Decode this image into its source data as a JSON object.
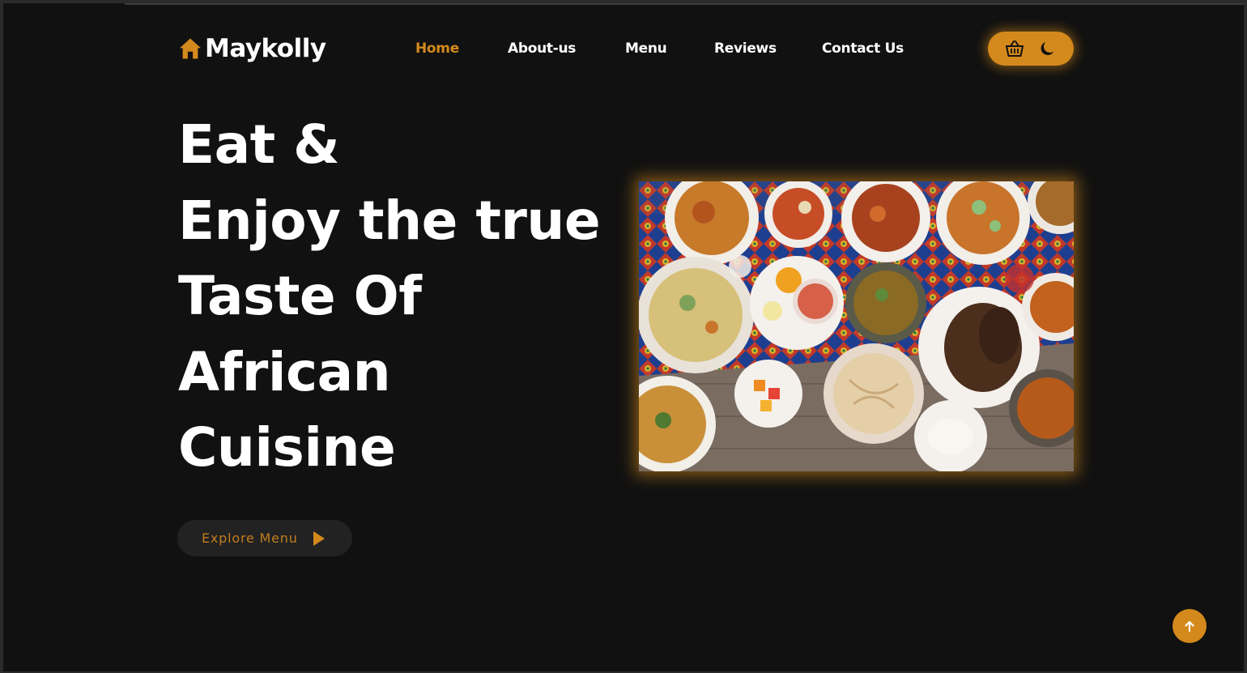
{
  "brand": {
    "name": "Maykolly",
    "icon": "home-icon"
  },
  "nav": {
    "items": [
      {
        "label": "Home",
        "active": true
      },
      {
        "label": "About-us",
        "active": false
      },
      {
        "label": "Menu",
        "active": false
      },
      {
        "label": "Reviews",
        "active": false
      },
      {
        "label": "Contact Us",
        "active": false
      }
    ]
  },
  "tools": {
    "cart_icon": "basket-icon",
    "theme_icon": "moon-icon"
  },
  "hero": {
    "title_lines": [
      "Eat &",
      "Enjoy the true",
      "Taste Of",
      "African",
      "Cuisine"
    ],
    "cta_label": "Explore Menu",
    "cta_icon": "play-icon"
  },
  "image": {
    "subject": "food-spread-photo"
  },
  "back_to_top_icon": "arrow-up-icon",
  "colors": {
    "accent": "#d4891c",
    "background": "#111111",
    "text": "#ffffff",
    "button_bg": "#222222"
  }
}
